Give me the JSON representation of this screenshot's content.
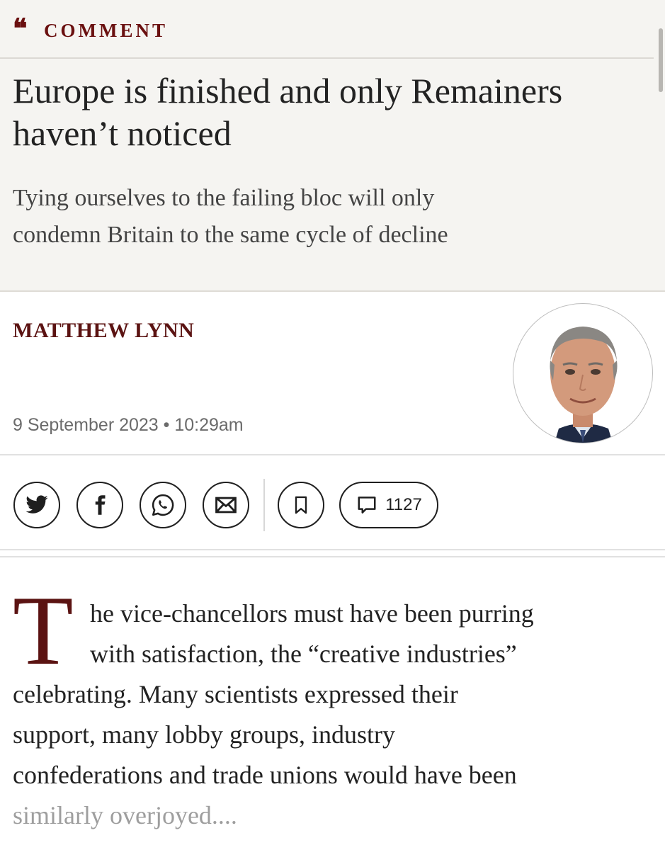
{
  "section": {
    "quote_glyph": "❝",
    "label": "COMMENT"
  },
  "article": {
    "headline_line1": "Europe is finished and only Remainers",
    "headline_line2": "haven’t noticed",
    "standfirst_line1": "Tying ourselves to the failing bloc will only",
    "standfirst_line2": "condemn Britain to the same cycle of decline",
    "author": "MATTHEW LYNN",
    "date": "9 September 2023 • 10:29am"
  },
  "actions": {
    "share": [
      {
        "icon": "twitter-icon"
      },
      {
        "icon": "facebook-icon"
      },
      {
        "icon": "whatsapp-icon"
      },
      {
        "icon": "email-icon"
      }
    ],
    "bookmark_icon": "bookmark-icon",
    "comment_icon": "comment-icon",
    "comment_count": "1127"
  },
  "body": {
    "dropcap": "T",
    "line1": "he vice-chancellors must have been purring",
    "line2": "with satisfaction, the “creative industries”",
    "line3": "celebrating. Many scientists expressed their",
    "line4": "support, many lobby groups, industry",
    "line5": "confederations and trade unions would have been",
    "line6": "similarly overjoyed...."
  },
  "colors": {
    "accent": "#6a1010",
    "header_bg": "#f5f4f1"
  }
}
